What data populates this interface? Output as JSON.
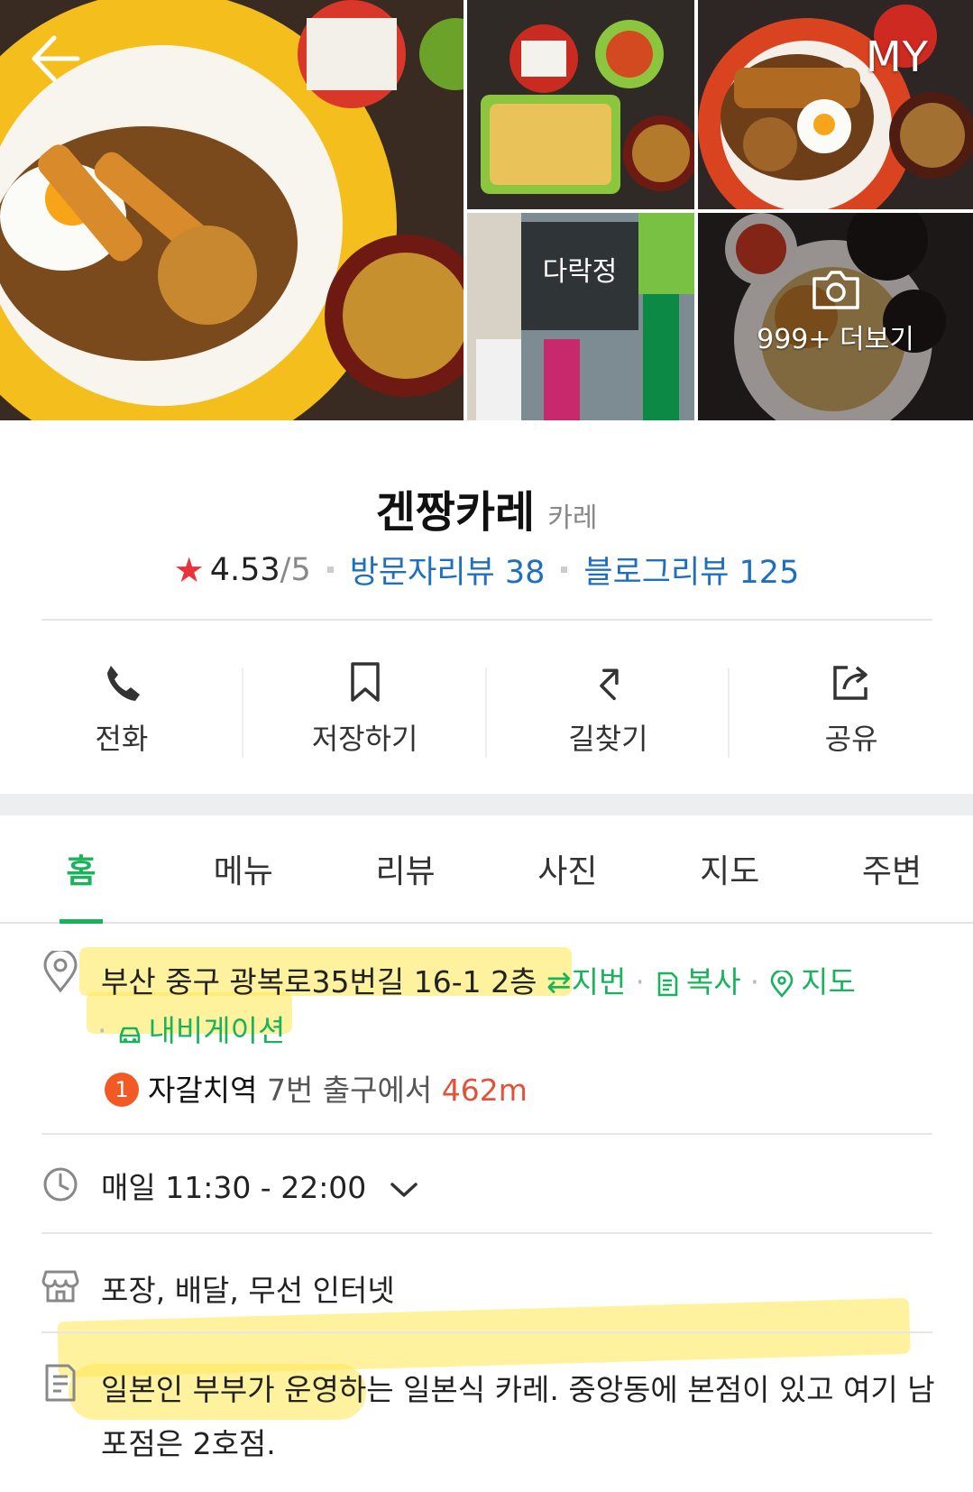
{
  "header": {
    "back_label": "뒤로",
    "my_label": "MY"
  },
  "gallery": {
    "more_label": "999+ 더보기"
  },
  "place": {
    "name": "겐짱카레",
    "category": "카레",
    "rating": "4.53",
    "rating_max": "/5",
    "visitor_reviews": "방문자리뷰 38",
    "blog_reviews": "블로그리뷰 125"
  },
  "actions": [
    {
      "label": "전화",
      "icon": "phone-icon"
    },
    {
      "label": "저장하기",
      "icon": "bookmark-icon"
    },
    {
      "label": "길찾기",
      "icon": "directions-icon"
    },
    {
      "label": "공유",
      "icon": "share-icon"
    }
  ],
  "tabs": [
    "홈",
    "메뉴",
    "리뷰",
    "사진",
    "지도",
    "주변"
  ],
  "info": {
    "address": "부산 중구 광복로35번길 16-1 2층",
    "lot_label": "지번",
    "copy_label": "복사",
    "map_label": "지도",
    "navigation_label": "내비게이션",
    "exit_number": "1",
    "station": "자갈치역",
    "exit_text": " 7번 출구에서 ",
    "distance": "462m",
    "hours": "매일 11:30 - 22:00",
    "services": "포장, 배달, 무선 인터넷",
    "description_line1": "일본인 부부가 운영하는 일본식 카레. 중앙동에 본점이 있고 여기 남",
    "description_line2": "포점은 2호점."
  },
  "colors": {
    "accent": "#19b35c",
    "link": "#1f6fbf",
    "star": "#e8333b",
    "highlight": "#ffe750",
    "distance": "#e0533a"
  }
}
